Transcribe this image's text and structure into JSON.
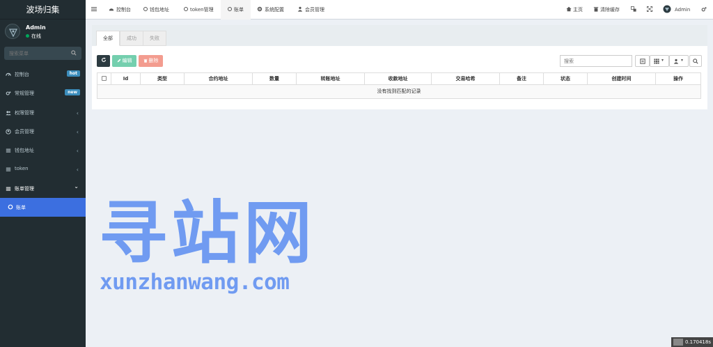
{
  "brand": {
    "title": "波场归集"
  },
  "user": {
    "name": "Admin",
    "status": "在线"
  },
  "sidebar": {
    "search_placeholder": "搜索菜单",
    "items": [
      {
        "label": "控制台",
        "icon": "dashboard-icon",
        "badge": "hot",
        "badge_color": "#3c8dbc"
      },
      {
        "label": "常规管理",
        "icon": "cogs-icon",
        "badge": "new",
        "badge_color": "#3c8dbc"
      },
      {
        "label": "权限管理",
        "icon": "users-icon",
        "chevron": "‹"
      },
      {
        "label": "会员管理",
        "icon": "user-circle-icon",
        "chevron": "‹"
      },
      {
        "label": "钱包地址",
        "icon": "list-icon",
        "chevron": "‹"
      },
      {
        "label": "token",
        "icon": "list-icon",
        "chevron": "‹"
      },
      {
        "label": "账单管理",
        "icon": "list-icon",
        "chevron": "⌄"
      }
    ],
    "sub_item": {
      "label": "账单",
      "icon": "circle-icon"
    }
  },
  "topbar": {
    "tabs": [
      {
        "label": "控制台",
        "icon": "dashboard-icon"
      },
      {
        "label": "钱包地址",
        "icon": "circle-icon"
      },
      {
        "label": "token管理",
        "icon": "circle-icon"
      },
      {
        "label": "账单",
        "icon": "circle-icon"
      },
      {
        "label": "系统配置",
        "icon": "gear-icon"
      },
      {
        "label": "会员管理",
        "icon": "user-icon"
      }
    ],
    "right": {
      "home": "主页",
      "clear_cache": "清除缓存",
      "admin": "Admin"
    }
  },
  "panel": {
    "tabs": [
      "全部",
      "成功",
      "失败"
    ],
    "buttons": {
      "edit": "编辑",
      "delete": "删除"
    },
    "search_placeholder": "搜索",
    "columns": [
      "Id",
      "类型",
      "合约地址",
      "数量",
      "转账地址",
      "收款地址",
      "交易哈希",
      "备注",
      "状态",
      "创建时间",
      "操作"
    ],
    "empty_text": "没有找到匹配的记录"
  },
  "watermark": {
    "cn": "寻站网",
    "en": "xunzhanwang.com"
  },
  "timer": {
    "value": "0.170418s"
  },
  "colors": {
    "sidebar_bg": "#222d32",
    "active_sub": "#3c6fe0",
    "refresh_btn": "#2c3b41",
    "edit_btn": "#74cfae",
    "delete_btn": "#f39c8f",
    "badge": "#3c8dbc"
  }
}
